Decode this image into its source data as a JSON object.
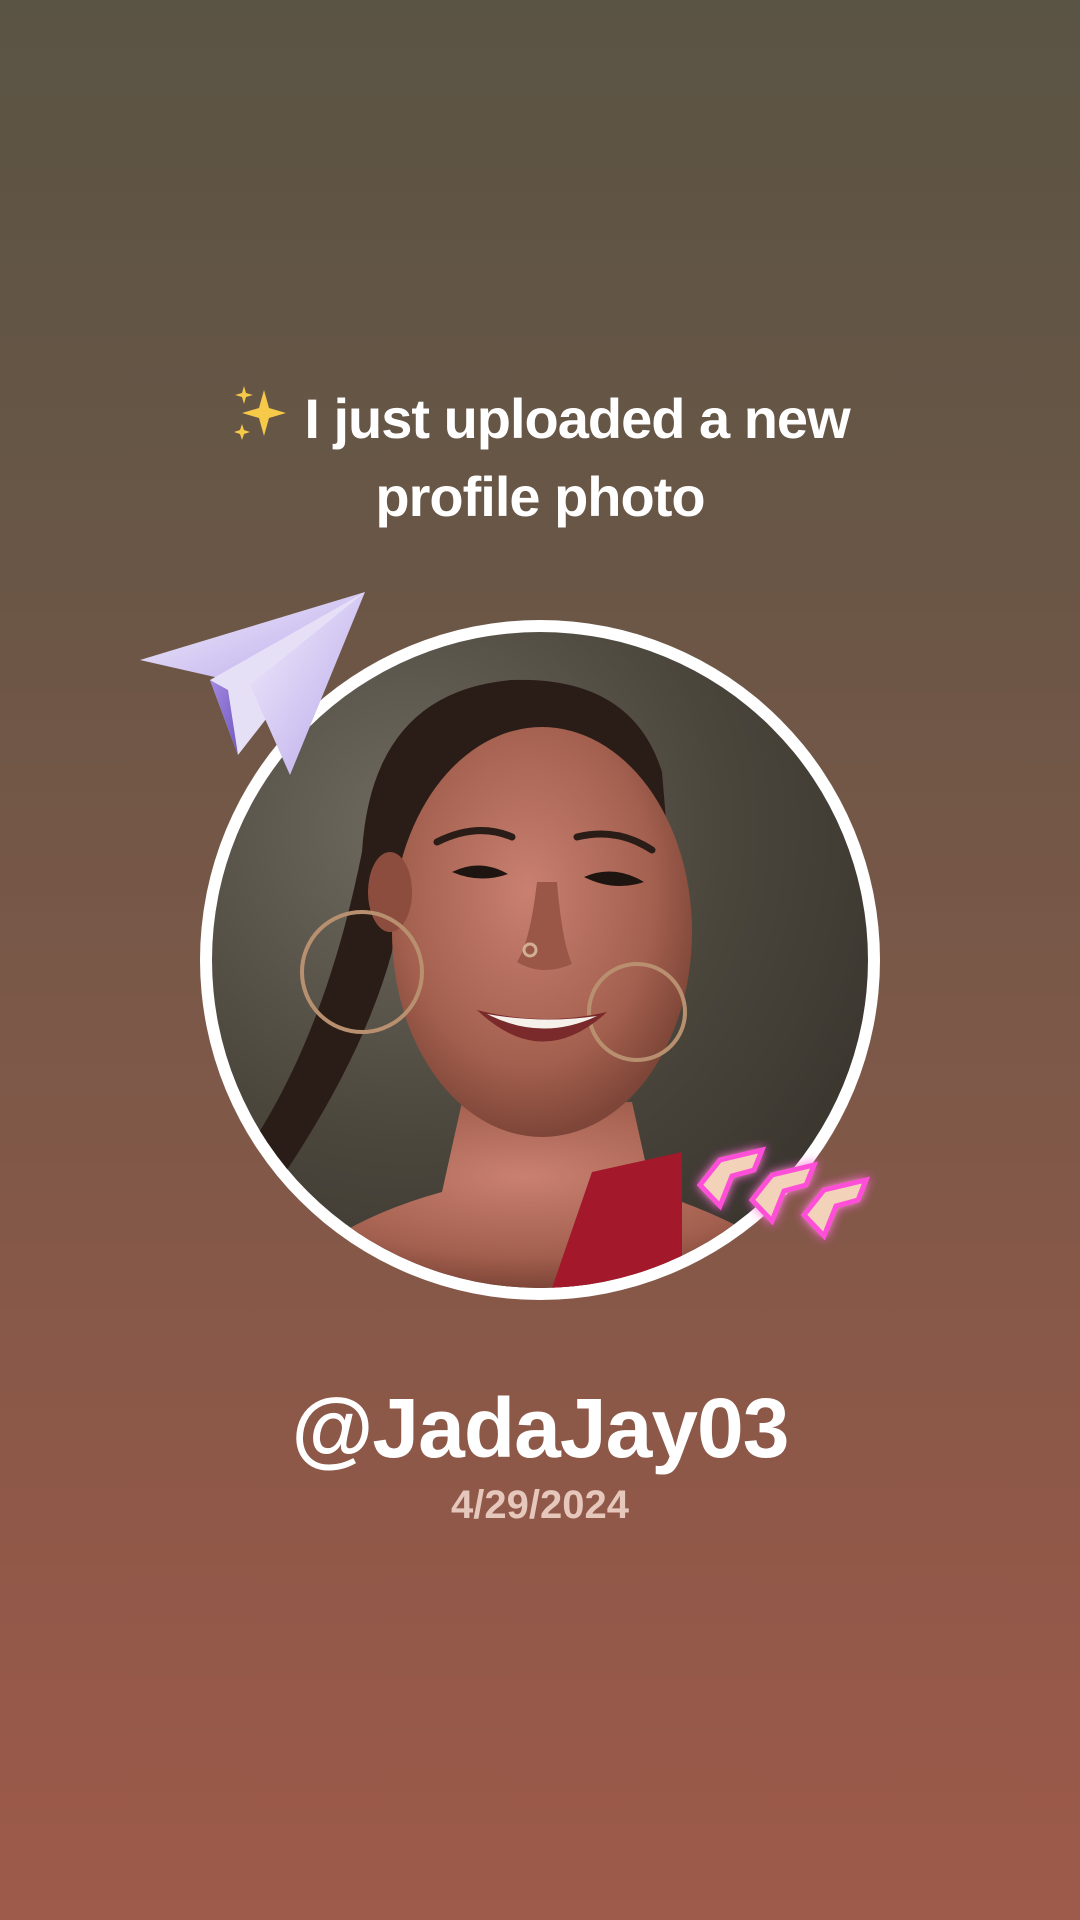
{
  "post": {
    "headline_line1": "I just uploaded a new",
    "headline_line2": "profile photo",
    "sparkle_icon": "sparkles-icon",
    "username": "@JadaJay03",
    "date": "4/29/2024"
  },
  "colors": {
    "gradient_top": "#5a5444",
    "gradient_bottom": "#9e5a4b",
    "ring": "#ffffff",
    "date_text": "#e6c7bb",
    "chevron_glow": "#ff4fd8",
    "plane": "#c9b8f0"
  },
  "decorations": {
    "paper_plane": "paper-plane-icon",
    "chevrons": "neon-chevrons-icon"
  }
}
